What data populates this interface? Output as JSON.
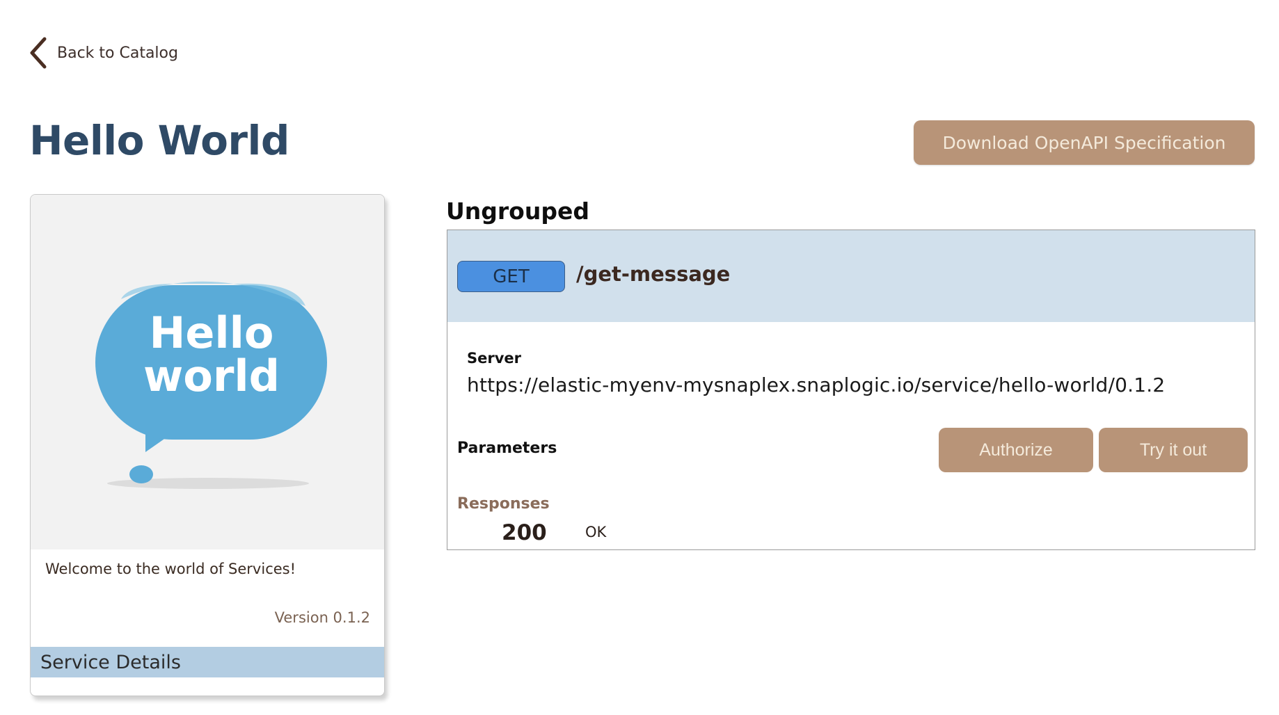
{
  "nav": {
    "back_label": "Back to Catalog"
  },
  "header": {
    "title": "Hello World",
    "download_label": "Download OpenAPI Specification"
  },
  "card": {
    "image_text_line1": "Hello",
    "image_text_line2": "world",
    "description": "Welcome to the world of Services!",
    "version": "Version 0.1.2",
    "details_label": "Service Details"
  },
  "group": {
    "title": "Ungrouped",
    "endpoint": {
      "method": "GET",
      "path": "/get-message",
      "server_label": "Server",
      "server_url": "https://elastic-myenv-mysnaplex.snaplogic.io/service/hello-world/0.1.2",
      "parameters_label": "Parameters",
      "authorize_label": "Authorize",
      "try_label": "Try it out",
      "responses_label": "Responses",
      "responses": [
        {
          "code": "200",
          "description": "OK"
        }
      ]
    }
  },
  "colors": {
    "accent_button": "#b89478",
    "title": "#2f4a66",
    "get_method": "#4b90e0",
    "endpoint_header": "#d1e0ec",
    "details_bar": "#b3cde2",
    "bubble": "#5aabd8"
  },
  "icons": {
    "back": "chevron-left-icon"
  }
}
